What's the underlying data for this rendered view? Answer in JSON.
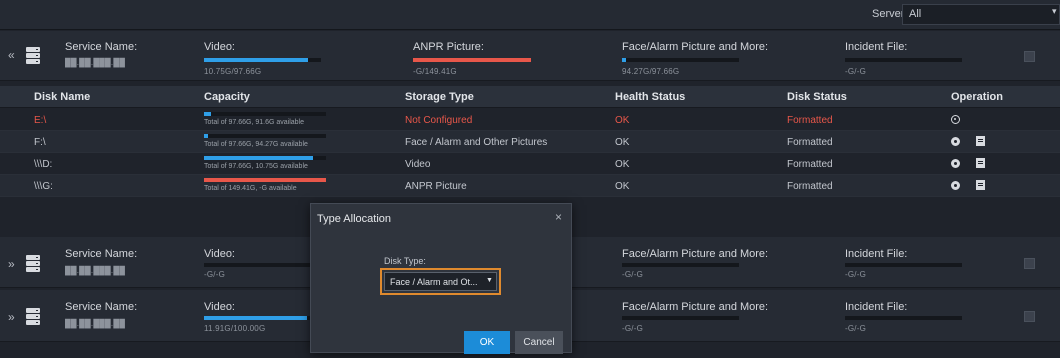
{
  "server_filter": {
    "label": "Server:",
    "value": "All"
  },
  "servers": [
    {
      "expand": "«",
      "name_label": "Service Name:",
      "name_value": "██.██.███.██",
      "video": {
        "label": "Video:",
        "value": "10.75G/97.66G",
        "fill": 0.89,
        "color": "#2f9fe8"
      },
      "anpr": {
        "label": "ANPR Picture:",
        "value": "-G/149.41G",
        "fill": 1.0,
        "color": "#e8574a"
      },
      "face": {
        "label": "Face/Alarm Picture and More:",
        "value": "94.27G/97.66G",
        "fill": 0.035,
        "color": "#2f9fe8"
      },
      "incident": {
        "label": "Incident File:",
        "value": "-G/-G",
        "fill": 0,
        "color": "#2f9fe8"
      }
    },
    {
      "expand": "»",
      "name_label": "Service Name:",
      "name_value": "██.██.███.██",
      "video": {
        "label": "Video:",
        "value": "-G/-G",
        "fill": 0,
        "color": "#2f9fe8"
      },
      "face": {
        "label": "Face/Alarm Picture and More:",
        "value": "-G/-G",
        "fill": 0,
        "color": "#2f9fe8"
      },
      "incident": {
        "label": "Incident File:",
        "value": "-G/-G",
        "fill": 0,
        "color": "#2f9fe8"
      }
    },
    {
      "expand": "»",
      "name_label": "Service Name:",
      "name_value": "██.██.███.██",
      "video": {
        "label": "Video:",
        "value": "11.91G/100.00G",
        "fill": 0.88,
        "color": "#2f9fe8"
      },
      "face": {
        "label": "Face/Alarm Picture and More:",
        "value": "-G/-G",
        "fill": 0,
        "color": "#2f9fe8"
      },
      "incident": {
        "label": "Incident File:",
        "value": "-G/-G",
        "fill": 0,
        "color": "#2f9fe8"
      }
    }
  ],
  "table": {
    "headers": [
      "Disk Name",
      "Capacity",
      "Storage Type",
      "Health Status",
      "Disk Status",
      "Operation"
    ],
    "rows": [
      {
        "name": "E:\\",
        "capacity": "Total of 97.66G,  91.6G available",
        "fill": 0.06,
        "type": "Not Configured",
        "health": "OK",
        "status": "Formatted",
        "error": true
      },
      {
        "name": "F:\\",
        "capacity": "Total of 97.66G,  94.27G available",
        "fill": 0.035,
        "type": "Face / Alarm and Other Pictures",
        "health": "OK",
        "status": "Formatted",
        "error": false
      },
      {
        "name": "\\\\\\D:",
        "capacity": "Total of 97.66G,  10.75G available",
        "fill": 0.89,
        "type": "Video",
        "health": "OK",
        "status": "Formatted",
        "error": false
      },
      {
        "name": "\\\\\\G:",
        "capacity": "Total of 149.41G,  -G available",
        "fill": 1.0,
        "type": "ANPR Picture",
        "health": "OK",
        "status": "Formatted",
        "error": false,
        "capacity_red": true
      }
    ]
  },
  "dialog": {
    "title": "Type Allocation",
    "close": "×",
    "disk_type_label": "Disk Type:",
    "disk_type_value": "Face / Alarm and Ot...",
    "ok": "OK",
    "cancel": "Cancel"
  },
  "colors": {
    "accent": "#1c8cd8",
    "error": "#e8574a",
    "highlight": "#e08a2e"
  }
}
